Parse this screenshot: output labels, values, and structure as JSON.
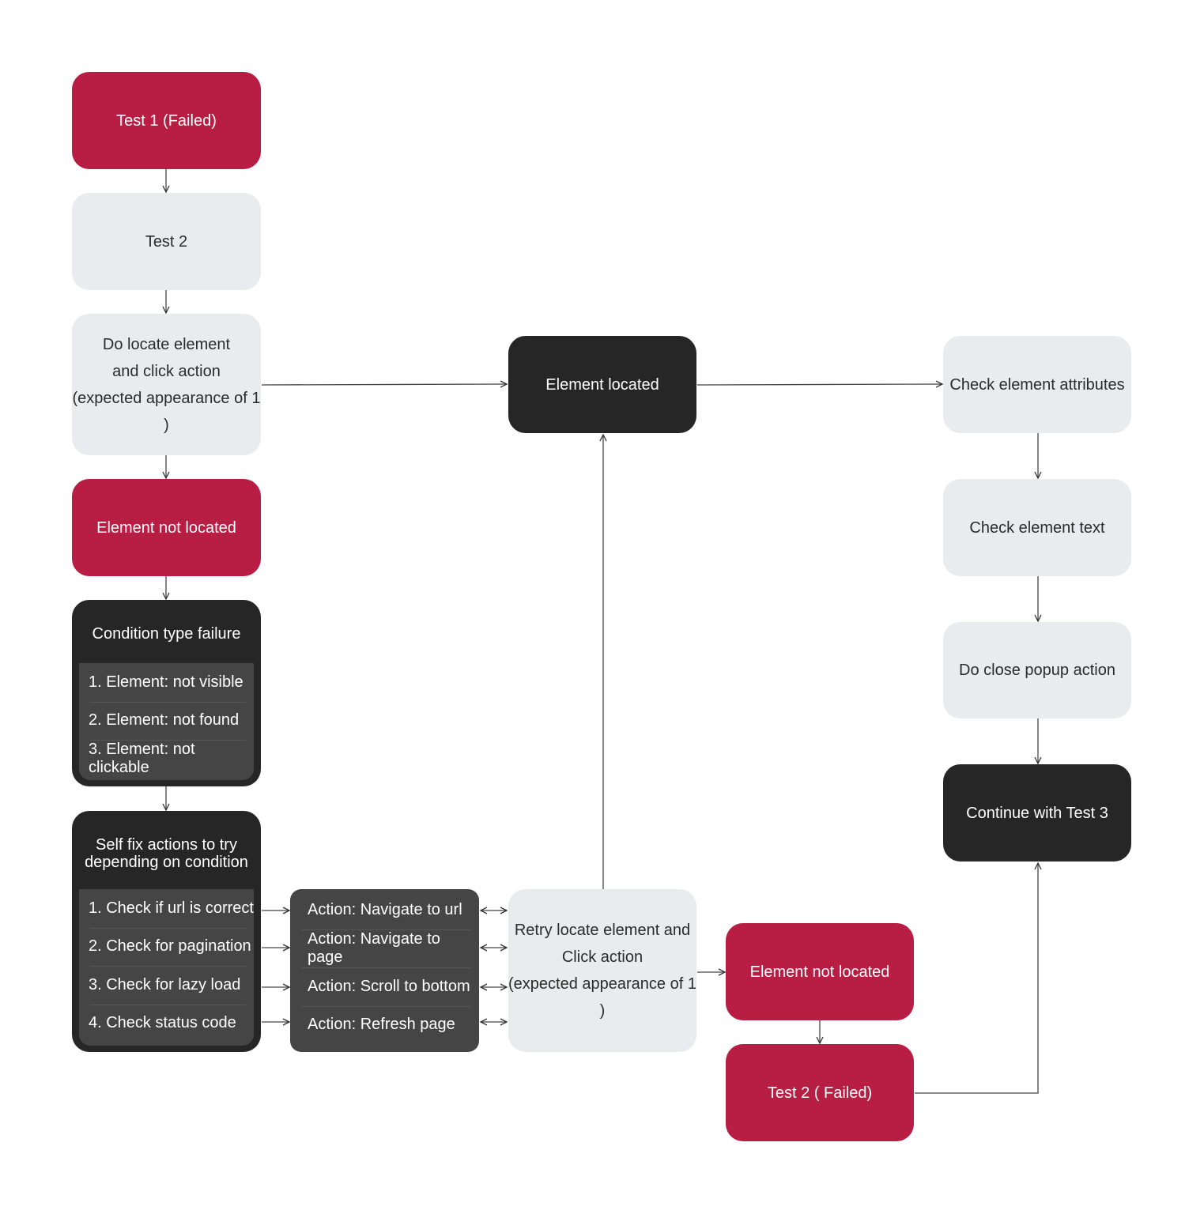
{
  "colors": {
    "failed": "#b81d43",
    "neutral": "#e9ebee",
    "dark": "#262626",
    "list": "#454545"
  },
  "nodes": {
    "test1": "Test 1 (Failed)",
    "test2": "Test 2",
    "do_locate": "Do locate element\nand click action\n(expected appearance of 1 )",
    "not_located_1": "Element not located",
    "element_located": "Element located",
    "check_attributes": "Check element attributes",
    "check_text": "Check element text",
    "close_popup": "Do close popup action",
    "continue_test3": "Continue with Test 3",
    "retry": "Retry locate element and\nClick action\n(expected appearance of 1 )",
    "not_located_2": "Element not located",
    "test2_failed": "Test 2 ( Failed)"
  },
  "condition": {
    "title": "Condition type failure",
    "items": [
      "1. Element: not visible",
      "2. Element: not found",
      "3. Element: not clickable"
    ]
  },
  "self_fix": {
    "title": "Self fix actions to try\ndepending on condition",
    "items": [
      "1. Check if url is correct",
      "2. Check for pagination",
      "3. Check for lazy load",
      "4. Check status code"
    ]
  },
  "actions": [
    "Action: Navigate to url",
    "Action: Navigate to page",
    "Action: Scroll to bottom",
    "Action: Refresh page"
  ]
}
